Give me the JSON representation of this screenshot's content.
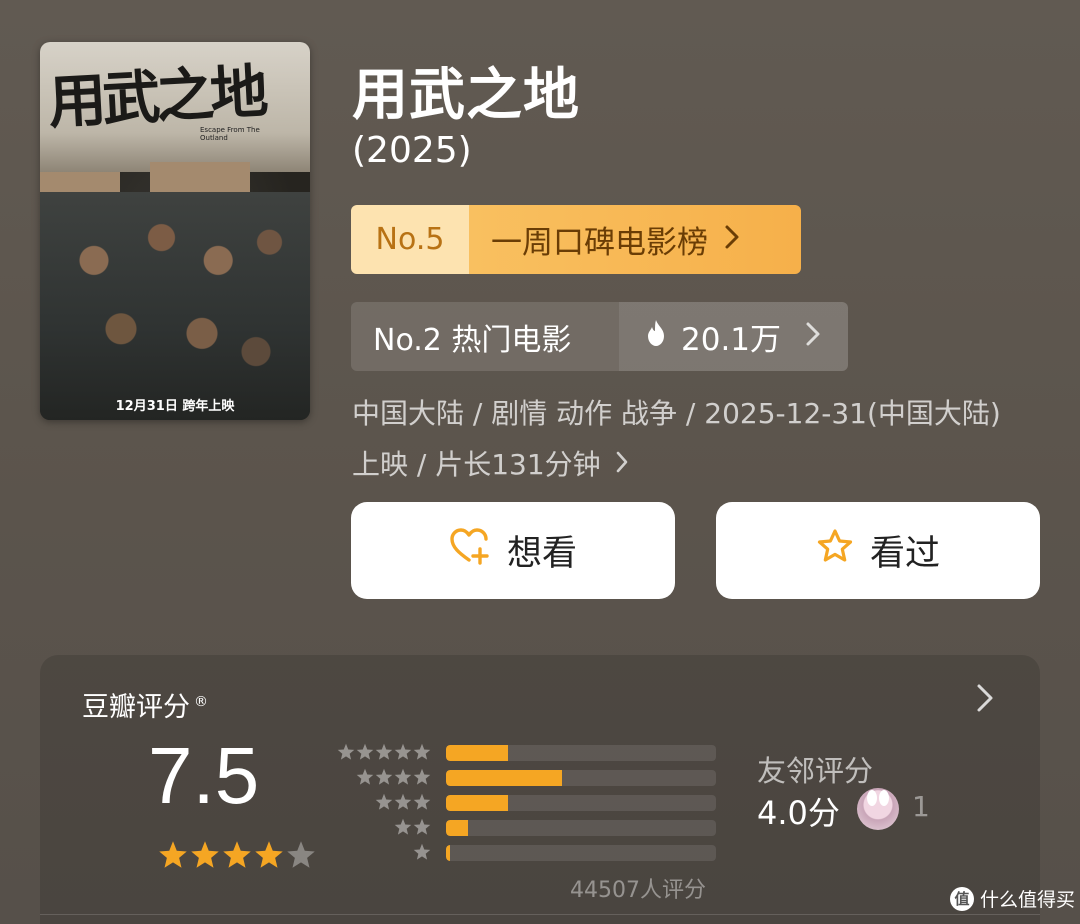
{
  "poster": {
    "title_art": "用武之地",
    "subtitle_art": "Escape From The Outland",
    "release_tag": "12月31日 跨年上映"
  },
  "movie": {
    "title": "用武之地",
    "year": "(2025)"
  },
  "rank_weekly": {
    "number": "No.5",
    "label": "一周口碑电影榜"
  },
  "rank_hot": {
    "label": "No.2 热门电影",
    "heat": "20.1万"
  },
  "meta": {
    "line1": "中国大陆 / 剧情 动作 战争 / 2025-12-31(中国大陆)",
    "line2": "上映 / 片长131分钟"
  },
  "actions": {
    "want_label": "想看",
    "seen_label": "看过"
  },
  "rating": {
    "title": "豆瓣评分",
    "registered": "®",
    "score": "7.5",
    "star_count": 4,
    "distribution": [
      {
        "stars": 5,
        "fraction": 0.23
      },
      {
        "stars": 4,
        "fraction": 0.43
      },
      {
        "stars": 3,
        "fraction": 0.23
      },
      {
        "stars": 2,
        "fraction": 0.08
      },
      {
        "stars": 1,
        "fraction": 0.015
      }
    ],
    "count_label": "44507人评分"
  },
  "friends": {
    "title": "友邻评分",
    "score": "4.0分",
    "count": "1"
  },
  "watermark": {
    "text": "什么值得买",
    "icon_char": "值"
  },
  "colors": {
    "accent_orange": "#f5a623",
    "rank_light": "#fde3b0"
  }
}
